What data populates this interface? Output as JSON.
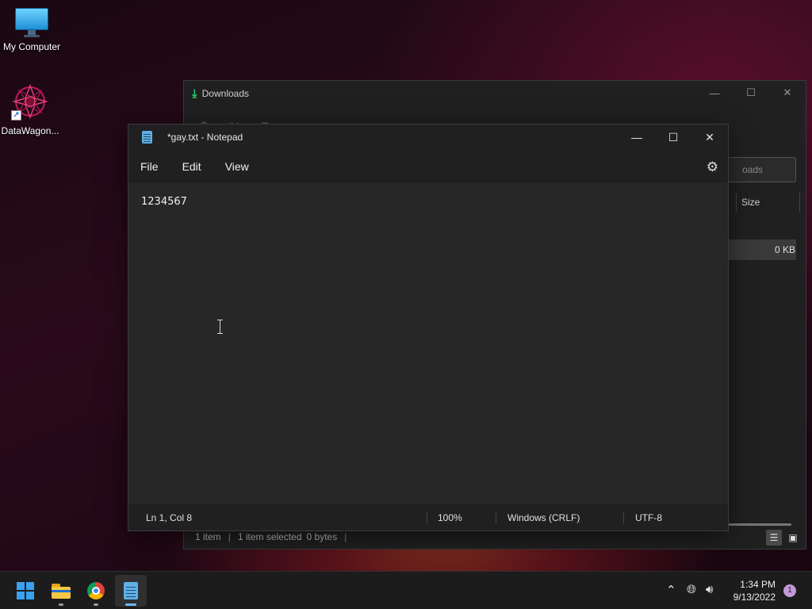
{
  "desktop": {
    "icons": [
      {
        "label": "My Computer",
        "icon": "monitor-icon"
      },
      {
        "label": "DataWagon...",
        "icon": "datawagon-logo-icon"
      }
    ]
  },
  "explorer": {
    "title": "Downloads",
    "search_placeholder": "Search Downloads",
    "search_visible_text": "oads",
    "column_size": "Size",
    "row_size": "0 KB",
    "status": {
      "items": "1 item",
      "selected": "1 item selected",
      "bytes": "0 bytes"
    }
  },
  "notepad": {
    "title": "*gay.txt - Notepad",
    "menu": [
      "File",
      "Edit",
      "View"
    ],
    "content": "1234567",
    "status": {
      "position": "Ln 1, Col 8",
      "zoom": "100%",
      "line_ending": "Windows (CRLF)",
      "encoding": "UTF-8"
    }
  },
  "taskbar": {
    "apps": [
      "start-button",
      "file-explorer",
      "chrome",
      "notepad"
    ],
    "clock_time": "1:34 PM",
    "clock_date": "9/13/2022",
    "notification_count": "1"
  },
  "colors": {
    "accent": "#6cb6ff",
    "windows_blue": "#3aa0f0",
    "download_green": "#2ecc71"
  }
}
